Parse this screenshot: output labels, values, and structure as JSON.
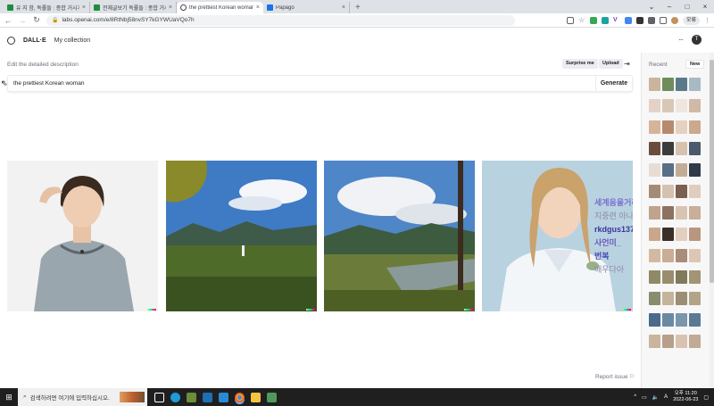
{
  "browser": {
    "tabs": [
      {
        "label": "유 지 함, 독률들 : 종합 거시기",
        "color": "#1e8e3e",
        "active": false
      },
      {
        "label": "전체글보기 독률들 : 종합 거시기",
        "color": "#1e8e3e",
        "active": false
      },
      {
        "label": "the prettiest Korean woman | D...",
        "color": "#444",
        "active": true
      },
      {
        "label": "Papago",
        "color": "#1a73e8",
        "active": false
      }
    ],
    "new_tab": "+",
    "url": "labs.openai.com/e/8RtNbj58nvSY7kGYWUaVQo7h",
    "profile_chip": "오류"
  },
  "app": {
    "brand": "DALL·E",
    "nav_link": "My collection",
    "user_initial": "T",
    "more": "···"
  },
  "editor": {
    "label": "Edit the detailed description",
    "surprise_label": "Surprise me",
    "upload_label": "Upload",
    "prompt_value": "the prettiest Korean woman",
    "generate_label": "Generate"
  },
  "results": {
    "images": [
      {
        "name": "result-image-1",
        "subject": "woman-grey-tshirt"
      },
      {
        "name": "result-image-2",
        "subject": "landscape-clouds"
      },
      {
        "name": "result-image-3",
        "subject": "landscape-field"
      },
      {
        "name": "result-image-4",
        "subject": "woman-white-polo"
      }
    ],
    "overlay_lines": [
      "세계음을거리에괴",
      "지중련 아나자. 차디",
      "rkdgus137",
      "사언미_",
      "번복",
      "배우다아"
    ],
    "report_label": "Report issue"
  },
  "sidebar": {
    "recent_label": "Recent",
    "new_label": "New"
  },
  "taskbar": {
    "search_placeholder": "검색하려면 여기에 입력하십시오.",
    "time": "오후 11:20",
    "date": "2022-06-23"
  },
  "colors": {
    "accent": "#202124",
    "sidebar_bg": "#f7f7f8",
    "taskbar_bg": "#1f1f1f"
  }
}
